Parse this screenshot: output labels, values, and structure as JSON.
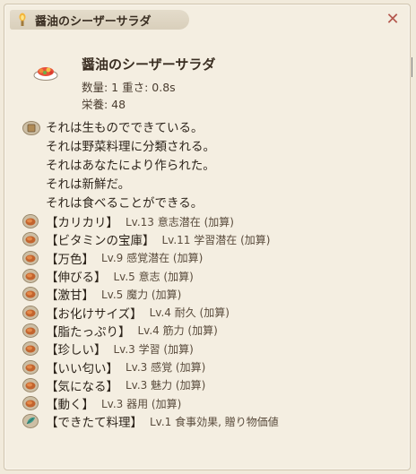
{
  "window": {
    "title": "醤油のシーザーサラダ",
    "close_glyph": "✕"
  },
  "item": {
    "name": "醤油のシーザーサラダ",
    "stats_line1": "数量: 1  重さ: 0.8s",
    "stats_line2": "栄養: 48"
  },
  "description": [
    "それは生ものでできている。",
    "それは野菜料理に分類される。",
    "それはあなたにより作られた。",
    "それは新鮮だ。",
    "それは食べることができる。"
  ],
  "traits": [
    {
      "name": "【カリカリ】",
      "detail": "Lv.13 意志潜在 (加算)",
      "icon": "meat-icon"
    },
    {
      "name": "【ビタミンの宝庫】",
      "detail": "Lv.11 学習潜在 (加算)",
      "icon": "meat-icon"
    },
    {
      "name": "【万色】",
      "detail": "Lv.9 感覚潜在 (加算)",
      "icon": "meat-icon"
    },
    {
      "name": "【伸びる】",
      "detail": "Lv.5 意志 (加算)",
      "icon": "meat-icon"
    },
    {
      "name": "【激甘】",
      "detail": "Lv.5 魔力 (加算)",
      "icon": "meat-icon"
    },
    {
      "name": "【お化けサイズ】",
      "detail": "Lv.4 耐久 (加算)",
      "icon": "meat-icon"
    },
    {
      "name": "【脂たっぷり】",
      "detail": "Lv.4 筋力 (加算)",
      "icon": "meat-icon"
    },
    {
      "name": "【珍しい】",
      "detail": "Lv.3 学習 (加算)",
      "icon": "meat-icon"
    },
    {
      "name": "【いい匂い】",
      "detail": "Lv.3 感覚 (加算)",
      "icon": "meat-icon"
    },
    {
      "name": "【気になる】",
      "detail": "Lv.3 魅力 (加算)",
      "icon": "meat-icon"
    },
    {
      "name": "【動く】",
      "detail": "Lv.3 器用 (加算)",
      "icon": "meat-icon"
    },
    {
      "name": "【できたて料理】",
      "detail": "Lv.1 食事効果, 贈り物価値",
      "icon": "leaf-icon"
    }
  ],
  "colors": {
    "background": "#f4eee1",
    "title_bar": "#ddd3c0",
    "close": "#b4584e",
    "text": "#2e251c"
  }
}
